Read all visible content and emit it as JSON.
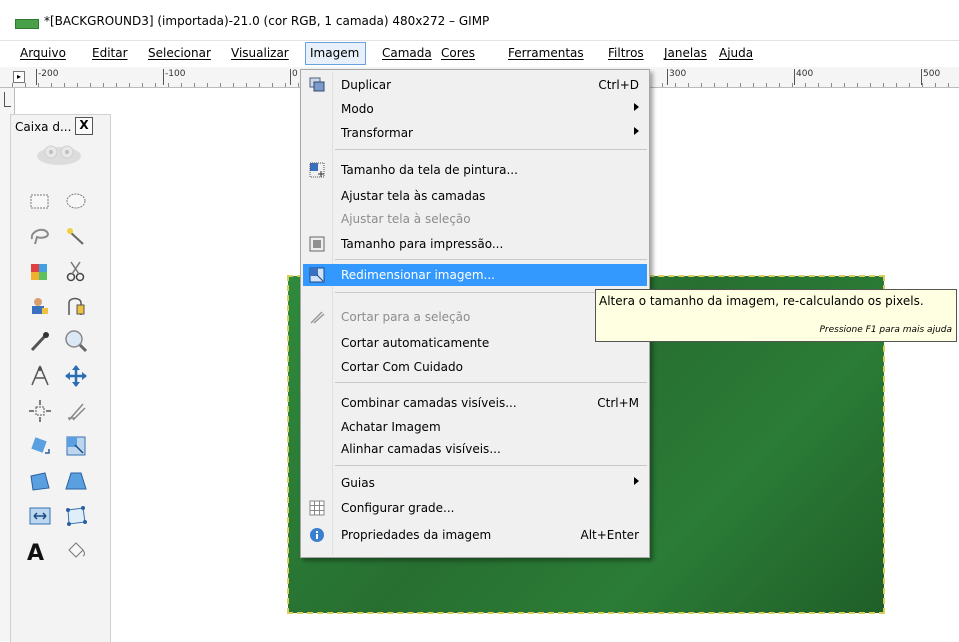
{
  "window": {
    "title": "*[BACKGROUND3] (importada)-21.0 (cor RGB, 1 camada) 480x272 – GIMP"
  },
  "menubar": {
    "items": [
      "Arquivo",
      "Editar",
      "Selecionar",
      "Visualizar",
      "Imagem",
      "Camada",
      "Cores",
      "Ferramentas",
      "Filtros",
      "Janelas",
      "Ajuda"
    ],
    "active": "Imagem"
  },
  "ruler": {
    "labels": [
      "-200",
      "-100",
      "0",
      "300",
      "400",
      "500"
    ]
  },
  "toolbox": {
    "title": "Caixa d...",
    "close": "X"
  },
  "image_menu": {
    "items": [
      {
        "label": "Duplicar",
        "accel": "Ctrl+D",
        "icon": "duplicate-icon"
      },
      {
        "label": "Modo",
        "submenu": true
      },
      {
        "label": "Transformar",
        "submenu": true
      },
      {
        "label": "Tamanho da tela de pintura...",
        "icon": "canvas-size-icon"
      },
      {
        "label": "Ajustar tela às camadas"
      },
      {
        "label": "Ajustar tela à seleção",
        "disabled": true
      },
      {
        "label": "Tamanho para impressão...",
        "icon": "print-size-icon"
      },
      {
        "label": "Redimensionar imagem...",
        "icon": "scale-image-icon",
        "highlighted": true
      },
      {
        "label": "Cortar para a seleção",
        "disabled": true,
        "icon": "crop-icon"
      },
      {
        "label": "Cortar automaticamente"
      },
      {
        "label": "Cortar Com Cuidado"
      },
      {
        "label": "Combinar camadas visíveis...",
        "accel": "Ctrl+M"
      },
      {
        "label": "Achatar Imagem"
      },
      {
        "label": "Alinhar camadas visíveis..."
      },
      {
        "label": "Guias",
        "submenu": true
      },
      {
        "label": "Configurar grade...",
        "icon": "grid-icon"
      },
      {
        "label": "Propriedades da imagem",
        "accel": "Alt+Enter",
        "icon": "info-icon"
      }
    ]
  },
  "tooltip": {
    "text": "Altera o tamanho da imagem, re-calculando os pixels.",
    "hint": "Pressione F1 para mais ajuda"
  },
  "colors": {
    "highlight": "#3399ff",
    "canvas": "#2b7c36",
    "tooltip_bg": "#ffffe1"
  }
}
